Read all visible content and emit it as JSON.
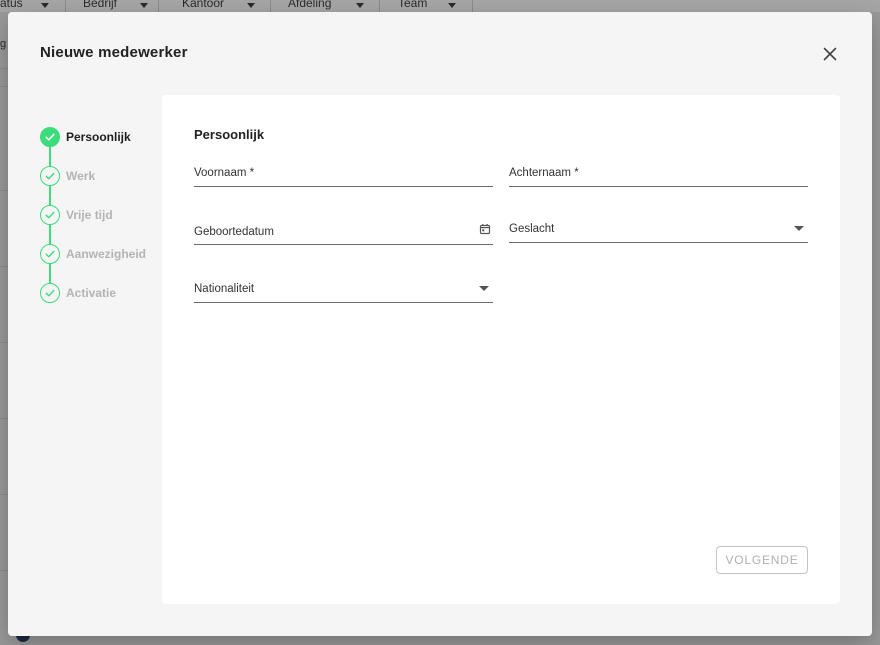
{
  "background": {
    "columns": [
      {
        "label": "atus"
      },
      {
        "label": "Bedrijf"
      },
      {
        "label": "Kantoor"
      },
      {
        "label": "Afdeling"
      },
      {
        "label": "Team"
      }
    ],
    "side_fragment": "g"
  },
  "modal": {
    "title": "Nieuwe medewerker",
    "close_icon": "close-icon"
  },
  "stepper": {
    "accent_color": "#3ddc7a",
    "steps": [
      {
        "label": "Persoonlijk",
        "active": true
      },
      {
        "label": "Werk",
        "active": false
      },
      {
        "label": "Vrije tijd",
        "active": false
      },
      {
        "label": "Aanwezigheid",
        "active": false
      },
      {
        "label": "Activatie",
        "active": false
      }
    ]
  },
  "form": {
    "section_title": "Persoonlijk",
    "fields": {
      "first_name": {
        "label": "Voornaam *",
        "value": ""
      },
      "last_name": {
        "label": "Achternaam *",
        "value": ""
      },
      "birth_date": {
        "label": "Geboortedatum",
        "value": "",
        "icon": "calendar-icon"
      },
      "gender": {
        "label": "Geslacht",
        "value": "",
        "icon": "dropdown-arrow-icon"
      },
      "nationality": {
        "label": "Nationaliteit",
        "value": "",
        "icon": "dropdown-arrow-icon"
      }
    },
    "next_label": "VOLGENDE"
  }
}
